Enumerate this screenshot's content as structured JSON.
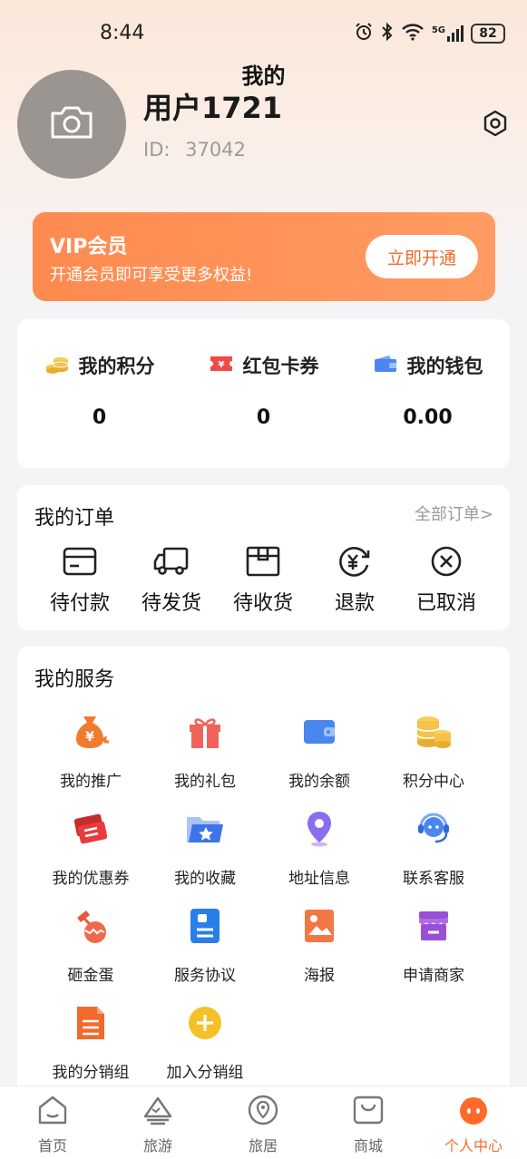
{
  "status": {
    "time": "8:44",
    "battery": "82",
    "network": "5G"
  },
  "header": {
    "title": "我的"
  },
  "profile": {
    "username": "用户1721",
    "id_label": "ID:",
    "id_value": "37042"
  },
  "vip": {
    "title": "VIP会员",
    "subtitle": "开通会员即可享受更多权益!",
    "button": "立即开通"
  },
  "stats": [
    {
      "label": "我的积分",
      "value": "0",
      "icon": "coins-icon"
    },
    {
      "label": "红包卡券",
      "value": "0",
      "icon": "ticket-icon"
    },
    {
      "label": "我的钱包",
      "value": "0.00",
      "icon": "wallet-icon"
    }
  ],
  "orders": {
    "title": "我的订单",
    "all_link": "全部订单>",
    "items": [
      {
        "label": "待付款",
        "icon": "card-icon"
      },
      {
        "label": "待发货",
        "icon": "truck-icon"
      },
      {
        "label": "待收货",
        "icon": "box-icon"
      },
      {
        "label": "退款",
        "icon": "refund-icon"
      },
      {
        "label": "已取消",
        "icon": "cancel-icon"
      }
    ]
  },
  "services": {
    "title": "我的服务",
    "items": [
      {
        "label": "我的推广",
        "icon": "money-bag-icon"
      },
      {
        "label": "我的礼包",
        "icon": "gift-icon"
      },
      {
        "label": "我的余额",
        "icon": "wallet-icon"
      },
      {
        "label": "积分中心",
        "icon": "coins-icon"
      },
      {
        "label": "我的优惠券",
        "icon": "coupon-icon"
      },
      {
        "label": "我的收藏",
        "icon": "favorite-folder-icon"
      },
      {
        "label": "地址信息",
        "icon": "location-pin-icon"
      },
      {
        "label": "联系客服",
        "icon": "headset-icon"
      },
      {
        "label": "砸金蛋",
        "icon": "golden-egg-icon"
      },
      {
        "label": "服务协议",
        "icon": "document-icon"
      },
      {
        "label": "海报",
        "icon": "poster-icon"
      },
      {
        "label": "申请商家",
        "icon": "shop-icon"
      },
      {
        "label": "我的分销组",
        "icon": "file-list-icon"
      },
      {
        "label": "加入分销组",
        "icon": "add-circle-icon"
      }
    ]
  },
  "tabbar": {
    "active": "个人中心",
    "items": [
      {
        "label": "首页",
        "icon": "home-icon"
      },
      {
        "label": "旅游",
        "icon": "mountain-icon"
      },
      {
        "label": "旅居",
        "icon": "location-icon"
      },
      {
        "label": "商城",
        "icon": "shop-bag-icon"
      },
      {
        "label": "个人中心",
        "icon": "profile-face-icon"
      }
    ]
  },
  "colors": {
    "accent": "#ff6a2a",
    "vip_gradient_start": "#ff8a4f",
    "vip_gradient_end": "#ff9b62"
  }
}
